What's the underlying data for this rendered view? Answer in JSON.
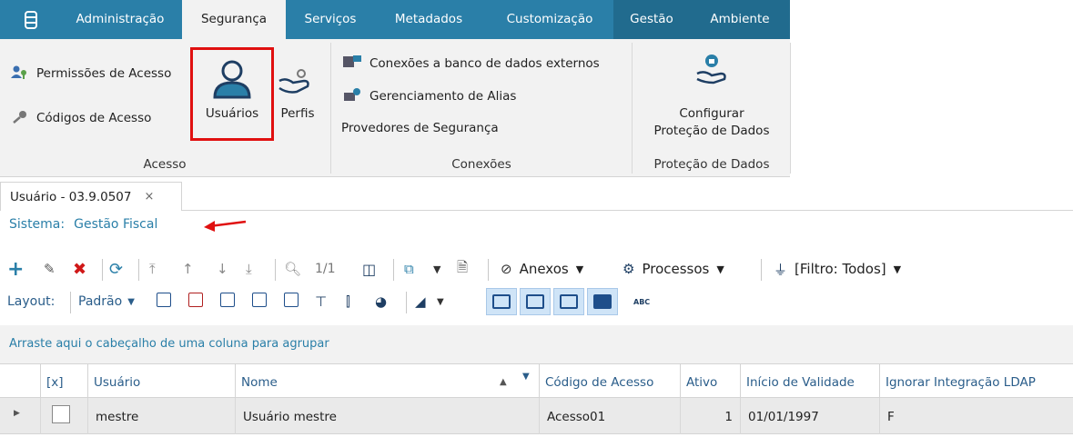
{
  "menubar": {
    "tabs": [
      {
        "label": "Administração"
      },
      {
        "label": "Segurança"
      },
      {
        "label": "Serviços"
      },
      {
        "label": "Metadados"
      },
      {
        "label": "Customização"
      },
      {
        "label": "Gestão"
      },
      {
        "label": "Ambiente"
      }
    ],
    "active_tab": "Segurança",
    "accent_color": "#2a7fa8"
  },
  "ribbon": {
    "acesso": {
      "permissoes": "Permissões de Acesso",
      "codigos": "Códigos de Acesso",
      "usuarios": "Usuários",
      "perfis": "Perfis",
      "group_label": "Acesso"
    },
    "conexoes": {
      "bancos": "Conexões a banco de dados externos",
      "alias": "Gerenciamento de Alias",
      "provedores": "Provedores de Segurança",
      "group_label": "Conexões"
    },
    "protecao": {
      "line1": "Configurar",
      "line2": "Proteção de Dados",
      "group_label": "Proteção de Dados"
    }
  },
  "document_tab": {
    "title": "Usuário - 03.9.0507",
    "close": "×"
  },
  "system": {
    "label": "Sistema:",
    "value": "Gestão Fiscal"
  },
  "toolbar": {
    "page_indicator": "1/1",
    "anexos": "Anexos",
    "processos": "Processos",
    "filtro": "[Filtro: Todos]",
    "layout_label": "Layout:",
    "layout_value": "Padrão",
    "abc": "ABC"
  },
  "group_hint": "Arraste aqui o cabeçalho de uma coluna para agrupar",
  "grid": {
    "columns": [
      "[x]",
      "Usuário",
      "Nome",
      "Código de Acesso",
      "Ativo",
      "Início de Validade",
      "Ignorar Integração LDAP"
    ],
    "rows": [
      {
        "usuario": "mestre",
        "nome": "Usuário mestre",
        "codigo": "Acesso01",
        "ativo": "1",
        "inicio": "01/01/1997",
        "ldap": "F"
      }
    ]
  }
}
